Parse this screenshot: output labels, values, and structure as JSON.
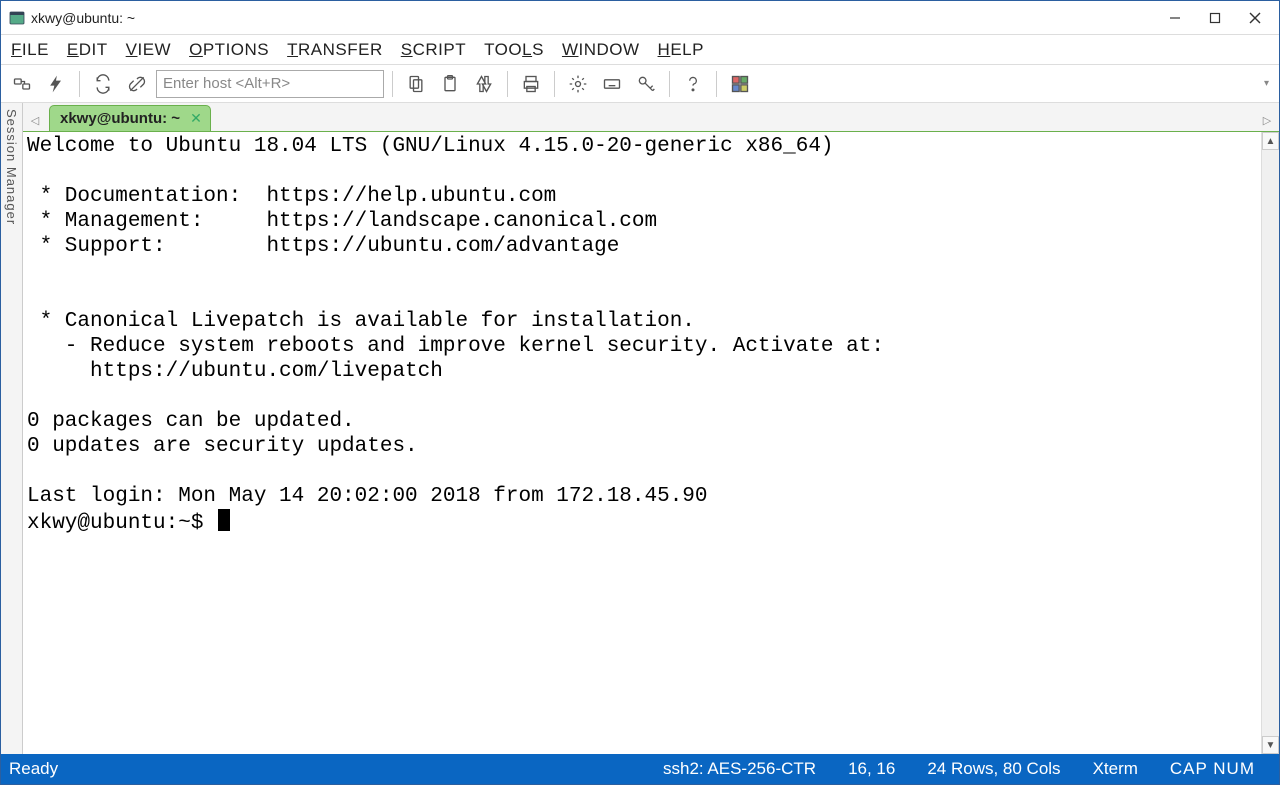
{
  "title": "xkwy@ubuntu: ~",
  "menu": [
    "FILE",
    "EDIT",
    "VIEW",
    "OPTIONS",
    "TRANSFER",
    "SCRIPT",
    "TOOLS",
    "WINDOW",
    "HELP"
  ],
  "host_placeholder": "Enter host <Alt+R>",
  "session_manager_label": "Session Manager",
  "tab": {
    "label": "xkwy@ubuntu: ~"
  },
  "terminal_lines": [
    "Welcome to Ubuntu 18.04 LTS (GNU/Linux 4.15.0-20-generic x86_64)",
    "",
    " * Documentation:  https://help.ubuntu.com",
    " * Management:     https://landscape.canonical.com",
    " * Support:        https://ubuntu.com/advantage",
    "",
    "",
    " * Canonical Livepatch is available for installation.",
    "   - Reduce system reboots and improve kernel security. Activate at:",
    "     https://ubuntu.com/livepatch",
    "",
    "0 packages can be updated.",
    "0 updates are security updates.",
    "",
    "Last login: Mon May 14 20:02:00 2018 from 172.18.45.90"
  ],
  "prompt": "xkwy@ubuntu:~$ ",
  "status": {
    "ready": "Ready",
    "conn": "ssh2: AES-256-CTR",
    "pos": "16, 16",
    "size": "24 Rows, 80 Cols",
    "term": "Xterm",
    "caps": "CAP NUM"
  }
}
